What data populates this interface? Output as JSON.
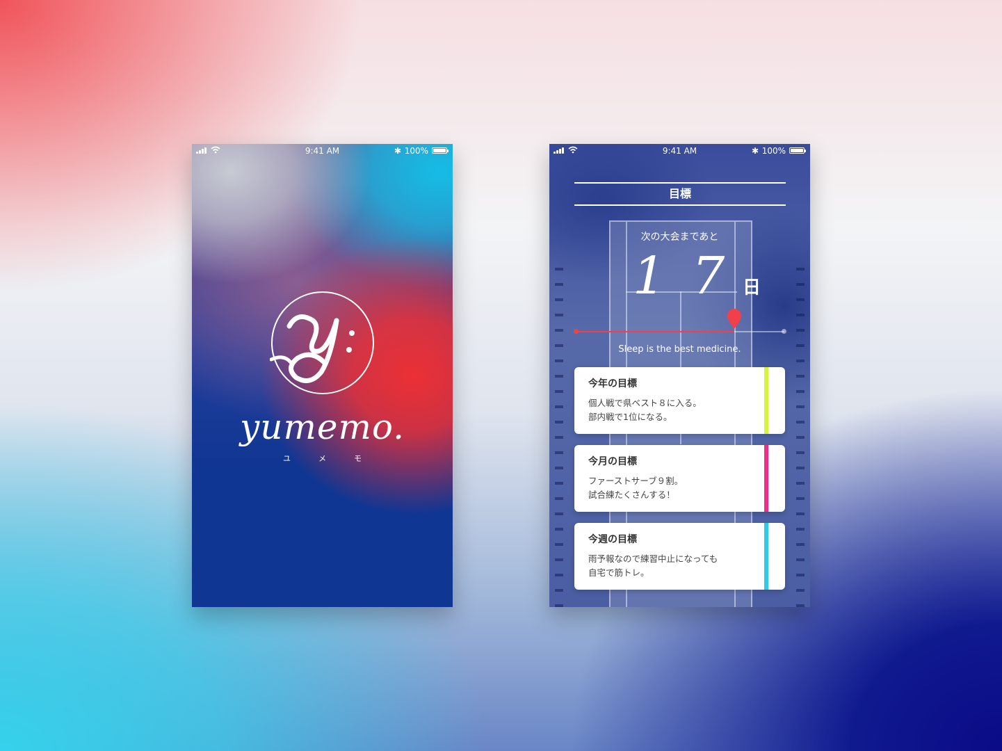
{
  "status_bar": {
    "time": "9:41 AM",
    "battery": "100%"
  },
  "splash": {
    "logo_letter": "Y.",
    "wordmark": "yumemo.",
    "kana": "ユメモ"
  },
  "goals_screen": {
    "title": "目標",
    "countdown_label": "次の大会まであと",
    "days": "17",
    "days_unit": "日",
    "progress_fraction": 0.76,
    "motto": "Sleep is the best medicine.",
    "cards": [
      {
        "title": "今年の目標",
        "line1": "個人戦で県ベスト８に入る。",
        "line2": "部内戦で1位になる。",
        "accent": "#d4f53c"
      },
      {
        "title": "今月の目標",
        "line1": "ファーストサーブ９割。",
        "line2": "試合練たくさんする！",
        "accent": "#ee2f86"
      },
      {
        "title": "今週の目標",
        "line1": "雨予報なので練習中止になっても",
        "line2": "自宅で筋トレ。",
        "accent": "#2ec9e2"
      }
    ]
  }
}
